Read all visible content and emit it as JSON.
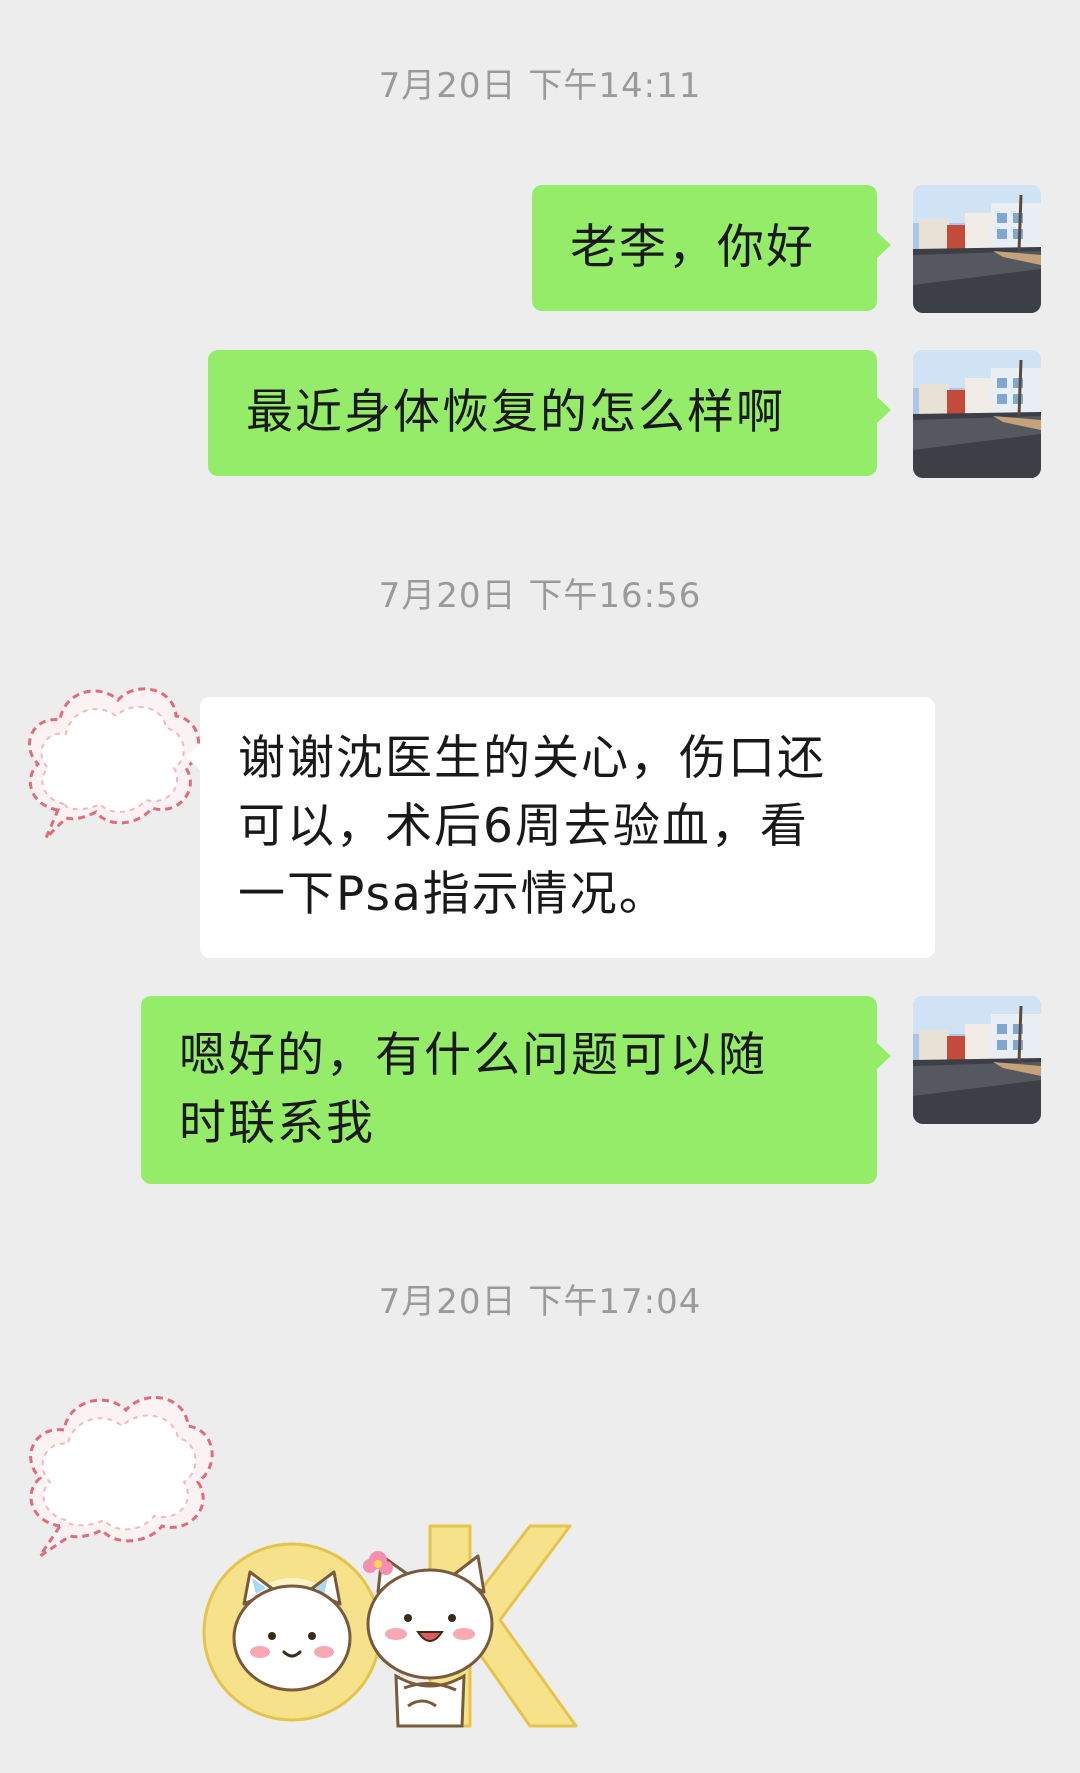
{
  "timestamps": [
    "7月20日 下午14:11",
    "7月20日 下午16:56",
    "7月20日 下午17:04"
  ],
  "messages": {
    "m1": {
      "lines": [
        "老李，你好"
      ]
    },
    "m2": {
      "lines": [
        "最近身体恢复的怎么样啊"
      ]
    },
    "m3": {
      "lines": [
        "谢谢沈医生的关心，伤口还",
        "可以，术后6周去验血，看",
        "一下Psa指示情况。"
      ]
    },
    "m4": {
      "lines": [
        "嗯好的，有什么问题可以随",
        "时联系我"
      ]
    }
  },
  "sticker": {
    "text": "OK",
    "colors": {
      "letters": "#f5e28a",
      "cat": "#ffffff",
      "outline": "#7a5a3a",
      "blush": "#f7a8b0",
      "flower": "#f48fb1"
    }
  },
  "colors": {
    "background": "#ededed",
    "sent_bubble": "#95ec69",
    "received_bubble": "#ffffff",
    "timestamp_text": "#9a9a9a",
    "message_text": "#191919"
  },
  "icons": {
    "sender_avatar": "street-photo-avatar",
    "contact_avatar": "pink-cloud-avatar"
  }
}
